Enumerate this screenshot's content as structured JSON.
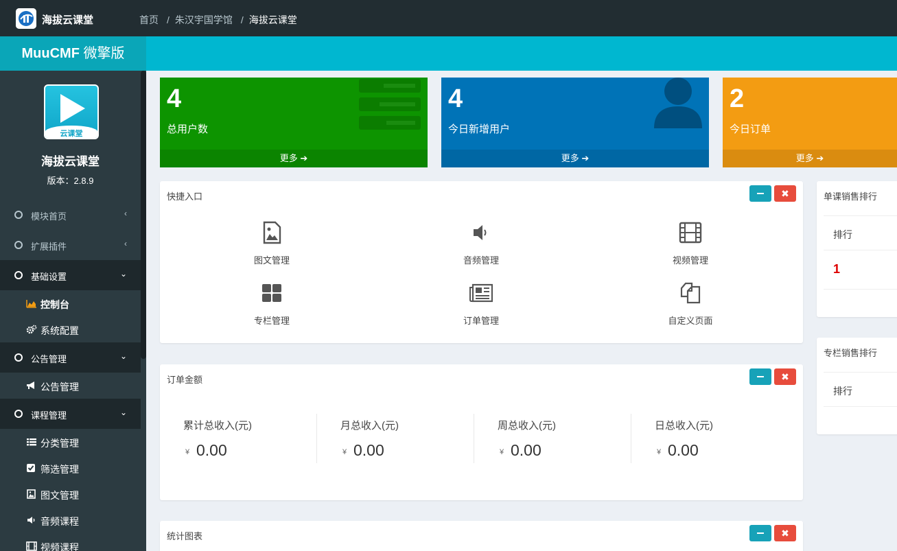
{
  "header": {
    "app_title": "海拔云课堂",
    "breadcrumb": [
      "首页",
      "朱汉宇国学馆",
      "海拔云课堂"
    ],
    "brand_main": "MuuCMF",
    "brand_suffix": " 微擎版"
  },
  "profile": {
    "logo_tag": "云课堂",
    "name": "海拔云课堂",
    "version": "版本：2.8.9"
  },
  "sidebar": {
    "groups": [
      {
        "label": "模块首页"
      },
      {
        "label": "扩展插件"
      },
      {
        "label": "基础设置",
        "items": [
          "控制台",
          "系统配置"
        ]
      },
      {
        "label": "公告管理",
        "items": [
          "公告管理"
        ]
      },
      {
        "label": "课程管理",
        "items": [
          "分类管理",
          "筛选管理",
          "图文管理",
          "音频课程",
          "视频课程"
        ]
      }
    ]
  },
  "stats": [
    {
      "value": "4",
      "label": "总用户数",
      "more": "更多"
    },
    {
      "value": "4",
      "label": "今日新增用户",
      "more": "更多"
    },
    {
      "value": "2",
      "label": "今日订单",
      "more": "更多"
    }
  ],
  "quick": {
    "title": "快捷入口",
    "items": [
      "图文管理",
      "音频管理",
      "视频管理",
      "专栏管理",
      "订单管理",
      "自定义页面"
    ]
  },
  "orders": {
    "title": "订单金额",
    "currency": "¥",
    "items": [
      {
        "label": "累计总收入(元)",
        "value": "0.00"
      },
      {
        "label": "月总收入(元)",
        "value": "0.00"
      },
      {
        "label": "周总收入(元)",
        "value": "0.00"
      },
      {
        "label": "日总收入(元)",
        "value": "0.00"
      }
    ]
  },
  "chart_panel": {
    "title": "统计图表"
  },
  "single_rank": {
    "title": "单课销售排行",
    "col_rank": "排行",
    "first_rank": "1"
  },
  "column_rank": {
    "title": "专栏销售排行",
    "col_rank": "排行"
  },
  "colors": {
    "green": "#0d9400",
    "blue": "#0073b7",
    "orange": "#f39c12",
    "teal": "#00b7d0",
    "dark": "#222d32"
  }
}
